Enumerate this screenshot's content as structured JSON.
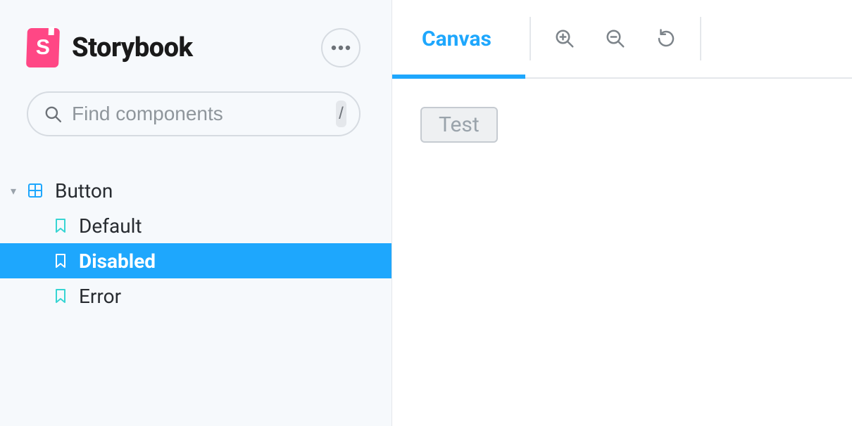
{
  "brand": {
    "title": "Storybook",
    "logo_letter": "S"
  },
  "search": {
    "placeholder": "Find components",
    "shortcut": "/"
  },
  "tree": {
    "component_label": "Button",
    "stories": [
      {
        "label": "Default",
        "selected": false
      },
      {
        "label": "Disabled",
        "selected": true
      },
      {
        "label": "Error",
        "selected": false
      }
    ]
  },
  "toolbar": {
    "canvas_tab": "Canvas"
  },
  "canvas": {
    "button_label": "Test"
  },
  "colors": {
    "accent": "#1ea7fd",
    "brand": "#ff4785"
  }
}
